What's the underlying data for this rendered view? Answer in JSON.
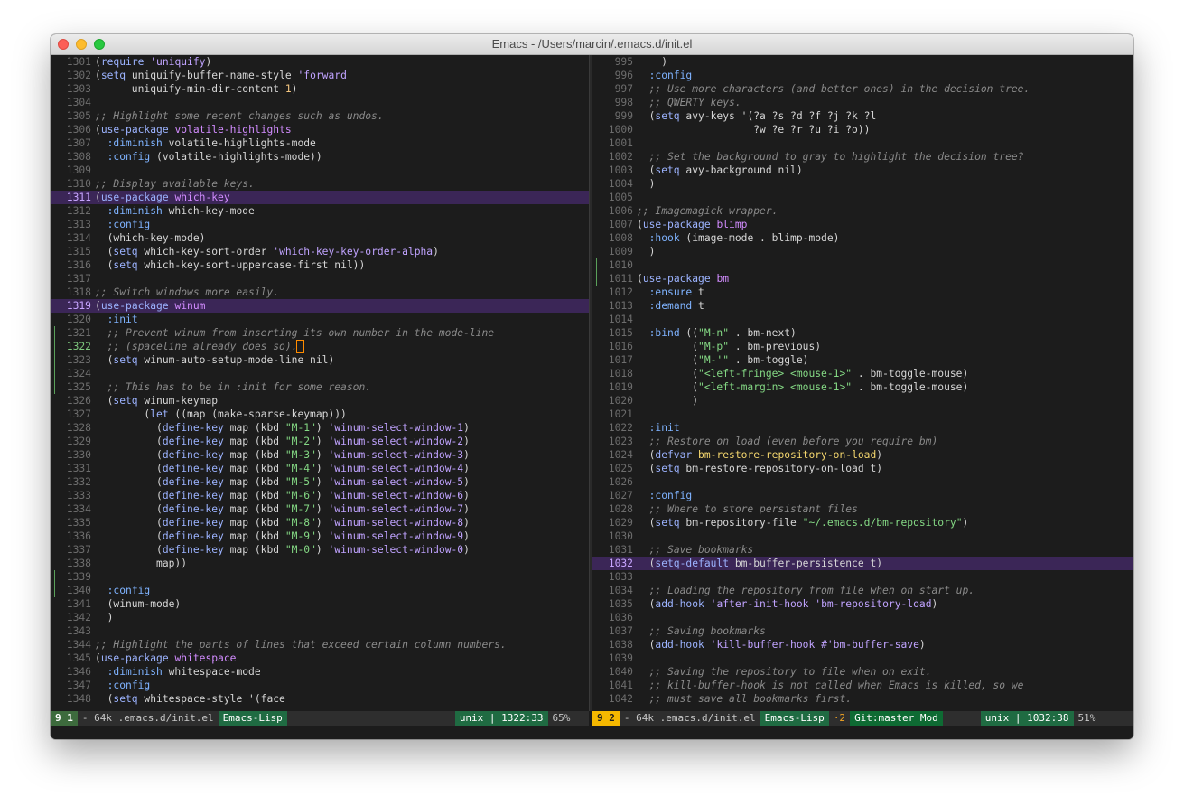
{
  "window": {
    "title": "Emacs - /Users/marcin/.emacs.d/init.el"
  },
  "left_pane": {
    "lines": [
      {
        "n": "1301",
        "t": "(require 'uniquify)"
      },
      {
        "n": "1302",
        "t": "(setq uniquify-buffer-name-style 'forward"
      },
      {
        "n": "1303",
        "t": "      uniquify-min-dir-content 1)"
      },
      {
        "n": "1304",
        "t": ""
      },
      {
        "n": "1305",
        "t": ";; Highlight some recent changes such as undos."
      },
      {
        "n": "1306",
        "t": "(use-package volatile-highlights"
      },
      {
        "n": "1307",
        "t": "  :diminish volatile-highlights-mode"
      },
      {
        "n": "1308",
        "t": "  :config (volatile-highlights-mode))"
      },
      {
        "n": "1309",
        "t": ""
      },
      {
        "n": "1310",
        "t": ";; Display available keys."
      },
      {
        "n": "1311",
        "t": "(use-package which-key",
        "hl": true
      },
      {
        "n": "1312",
        "t": "  :diminish which-key-mode"
      },
      {
        "n": "1313",
        "t": "  :config"
      },
      {
        "n": "1314",
        "t": "  (which-key-mode)"
      },
      {
        "n": "1315",
        "t": "  (setq which-key-sort-order 'which-key-key-order-alpha)"
      },
      {
        "n": "1316",
        "t": "  (setq which-key-sort-uppercase-first nil))"
      },
      {
        "n": "1317",
        "t": ""
      },
      {
        "n": "1318",
        "t": ";; Switch windows more easily."
      },
      {
        "n": "1319",
        "t": "(use-package winum",
        "hl": true
      },
      {
        "n": "1320",
        "t": "  :init"
      },
      {
        "n": "1321",
        "t": "  ;; Prevent winum from inserting its own number in the mode-line",
        "g": true
      },
      {
        "n": "1322",
        "t": "  ;; (spaceline already does so).",
        "g": true,
        "cur": true
      },
      {
        "n": "1323",
        "t": "  (setq winum-auto-setup-mode-line nil)",
        "g": true
      },
      {
        "n": "1324",
        "t": "",
        "g": true
      },
      {
        "n": "1325",
        "t": "  ;; This has to be in :init for some reason.",
        "g": true
      },
      {
        "n": "1326",
        "t": "  (setq winum-keymap"
      },
      {
        "n": "1327",
        "t": "        (let ((map (make-sparse-keymap)))"
      },
      {
        "n": "1328",
        "t": "          (define-key map (kbd \"M-1\") 'winum-select-window-1)"
      },
      {
        "n": "1329",
        "t": "          (define-key map (kbd \"M-2\") 'winum-select-window-2)"
      },
      {
        "n": "1330",
        "t": "          (define-key map (kbd \"M-3\") 'winum-select-window-3)"
      },
      {
        "n": "1331",
        "t": "          (define-key map (kbd \"M-4\") 'winum-select-window-4)"
      },
      {
        "n": "1332",
        "t": "          (define-key map (kbd \"M-5\") 'winum-select-window-5)"
      },
      {
        "n": "1333",
        "t": "          (define-key map (kbd \"M-6\") 'winum-select-window-6)"
      },
      {
        "n": "1334",
        "t": "          (define-key map (kbd \"M-7\") 'winum-select-window-7)"
      },
      {
        "n": "1335",
        "t": "          (define-key map (kbd \"M-8\") 'winum-select-window-8)"
      },
      {
        "n": "1336",
        "t": "          (define-key map (kbd \"M-9\") 'winum-select-window-9)"
      },
      {
        "n": "1337",
        "t": "          (define-key map (kbd \"M-0\") 'winum-select-window-0)"
      },
      {
        "n": "1338",
        "t": "          map))"
      },
      {
        "n": "1339",
        "t": "",
        "g": true
      },
      {
        "n": "1340",
        "t": "  :config",
        "g": true
      },
      {
        "n": "1341",
        "t": "  (winum-mode)"
      },
      {
        "n": "1342",
        "t": "  )"
      },
      {
        "n": "1343",
        "t": ""
      },
      {
        "n": "1344",
        "t": ";; Highlight the parts of lines that exceed certain column numbers."
      },
      {
        "n": "1345",
        "t": "(use-package whitespace"
      },
      {
        "n": "1346",
        "t": "  :diminish whitespace-mode"
      },
      {
        "n": "1347",
        "t": "  :config"
      },
      {
        "n": "1348",
        "t": "  (setq whitespace-style '(face"
      }
    ]
  },
  "right_pane": {
    "lines": [
      {
        "n": "995",
        "t": "    )"
      },
      {
        "n": "996",
        "t": "  :config"
      },
      {
        "n": "997",
        "t": "  ;; Use more characters (and better ones) in the decision tree."
      },
      {
        "n": "998",
        "t": "  ;; QWERTY keys."
      },
      {
        "n": "999",
        "t": "  (setq avy-keys '(?a ?s ?d ?f ?j ?k ?l"
      },
      {
        "n": "1000",
        "t": "                   ?w ?e ?r ?u ?i ?o))"
      },
      {
        "n": "1001",
        "t": ""
      },
      {
        "n": "1002",
        "t": "  ;; Set the background to gray to highlight the decision tree?"
      },
      {
        "n": "1003",
        "t": "  (setq avy-background nil)"
      },
      {
        "n": "1004",
        "t": "  )"
      },
      {
        "n": "1005",
        "t": ""
      },
      {
        "n": "1006",
        "t": ";; Imagemagick wrapper."
      },
      {
        "n": "1007",
        "t": "(use-package blimp"
      },
      {
        "n": "1008",
        "t": "  :hook (image-mode . blimp-mode)"
      },
      {
        "n": "1009",
        "t": "  )"
      },
      {
        "n": "1010",
        "t": "",
        "g": true
      },
      {
        "n": "1011",
        "t": "(use-package bm",
        "g": true
      },
      {
        "n": "1012",
        "t": "  :ensure t"
      },
      {
        "n": "1013",
        "t": "  :demand t"
      },
      {
        "n": "1014",
        "t": ""
      },
      {
        "n": "1015",
        "t": "  :bind ((\"M-n\" . bm-next)"
      },
      {
        "n": "1016",
        "t": "         (\"M-p\" . bm-previous)"
      },
      {
        "n": "1017",
        "t": "         (\"M-'\" . bm-toggle)"
      },
      {
        "n": "1018",
        "t": "         (\"<left-fringe> <mouse-1>\" . bm-toggle-mouse)"
      },
      {
        "n": "1019",
        "t": "         (\"<left-margin> <mouse-1>\" . bm-toggle-mouse)"
      },
      {
        "n": "1020",
        "t": "         )"
      },
      {
        "n": "1021",
        "t": ""
      },
      {
        "n": "1022",
        "t": "  :init"
      },
      {
        "n": "1023",
        "t": "  ;; Restore on load (even before you require bm)"
      },
      {
        "n": "1024",
        "t": "  (defvar bm-restore-repository-on-load)"
      },
      {
        "n": "1025",
        "t": "  (setq bm-restore-repository-on-load t)"
      },
      {
        "n": "1026",
        "t": ""
      },
      {
        "n": "1027",
        "t": "  :config"
      },
      {
        "n": "1028",
        "t": "  ;; Where to store persistant files"
      },
      {
        "n": "1029",
        "t": "  (setq bm-repository-file \"~/.emacs.d/bm-repository\")"
      },
      {
        "n": "1030",
        "t": ""
      },
      {
        "n": "1031",
        "t": "  ;; Save bookmarks"
      },
      {
        "n": "1032",
        "t": "  (setq-default bm-buffer-persistence t)",
        "hl": true
      },
      {
        "n": "1033",
        "t": ""
      },
      {
        "n": "1034",
        "t": "  ;; Loading the repository from file when on start up."
      },
      {
        "n": "1035",
        "t": "  (add-hook 'after-init-hook 'bm-repository-load)"
      },
      {
        "n": "1036",
        "t": ""
      },
      {
        "n": "1037",
        "t": "  ;; Saving bookmarks"
      },
      {
        "n": "1038",
        "t": "  (add-hook 'kill-buffer-hook #'bm-buffer-save)"
      },
      {
        "n": "1039",
        "t": ""
      },
      {
        "n": "1040",
        "t": "  ;; Saving the repository to file when on exit."
      },
      {
        "n": "1041",
        "t": "  ;; kill-buffer-hook is not called when Emacs is killed, so we"
      },
      {
        "n": "1042",
        "t": "  ;; must save all bookmarks first."
      }
    ]
  },
  "modeline_left": {
    "window_num": "9 1",
    "buffer": "- 64k .emacs.d/init.el",
    "mode": "Emacs-Lisp",
    "encoding": "unix | 1322:33",
    "percent": "65%"
  },
  "modeline_right": {
    "window_num": "9 2",
    "buffer": "- 64k .emacs.d/init.el",
    "mode": "Emacs-Lisp",
    "warnings": "·2",
    "git": "Git:master Mod",
    "encoding": "unix | 1032:38",
    "percent": "51%"
  },
  "colors": {
    "background": "#1c1c1c",
    "highlight_line": "#3b2657",
    "keyword": "#9cb3ff",
    "package": "#d28cff",
    "string": "#84d884",
    "comment": "#8a8a8a",
    "active_window": "#f5b800",
    "mode_green": "#1f6b42"
  }
}
